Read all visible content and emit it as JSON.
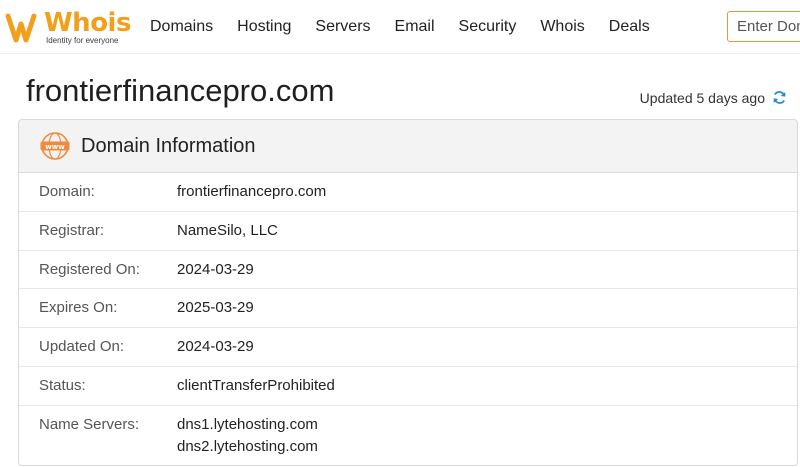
{
  "brand": {
    "name": "Whois",
    "tagline": "Identity for everyone",
    "accent": "#f2a01c"
  },
  "nav": {
    "items": [
      "Domains",
      "Hosting",
      "Servers",
      "Email",
      "Security",
      "Whois",
      "Deals"
    ]
  },
  "search": {
    "placeholder": "Enter Domain"
  },
  "page": {
    "title": "frontierfinancepro.com",
    "updated": "Updated 5 days ago"
  },
  "card": {
    "title": "Domain Information",
    "icon": "www-icon",
    "rows": [
      {
        "label": "Domain:",
        "value": "frontierfinancepro.com"
      },
      {
        "label": "Registrar:",
        "value": "NameSilo, LLC"
      },
      {
        "label": "Registered On:",
        "value": "2024-03-29"
      },
      {
        "label": "Expires On:",
        "value": "2025-03-29"
      },
      {
        "label": "Updated On:",
        "value": "2024-03-29"
      },
      {
        "label": "Status:",
        "value": "clientTransferProhibited"
      }
    ],
    "name_servers": {
      "label": "Name Servers:",
      "values": [
        "dns1.lytehosting.com",
        "dns2.lytehosting.com"
      ]
    }
  }
}
